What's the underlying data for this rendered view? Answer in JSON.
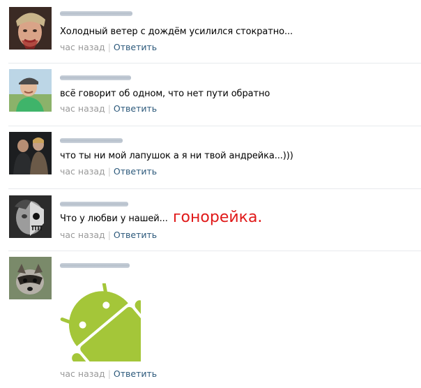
{
  "comments": [
    {
      "text": "Холодный ветер с дождём усилился стократно...",
      "time": "час назад",
      "separator": "|",
      "reply": "Ответить"
    },
    {
      "text": "всё говорит об одном, что нет пути обратно",
      "time": "час назад",
      "separator": "|",
      "reply": "Ответить"
    },
    {
      "text": "что ты ни мой лапушок а я ни твой андрейка...)))",
      "time": "час назад",
      "separator": "|",
      "reply": "Ответить"
    },
    {
      "text": "Что у любви у нашей...",
      "time": "час назад",
      "separator": "|",
      "reply": "Ответить"
    },
    {
      "text": "",
      "time": "час назад",
      "separator": "|",
      "reply": "Ответить"
    }
  ],
  "overlay_caption": "гонорейка.",
  "colors": {
    "meta_text": "#999999",
    "reply_link": "#2b587a",
    "overlay_caption": "#e01919",
    "android_green": "#a4c639"
  },
  "sticker_icon": "android-robot-icon"
}
